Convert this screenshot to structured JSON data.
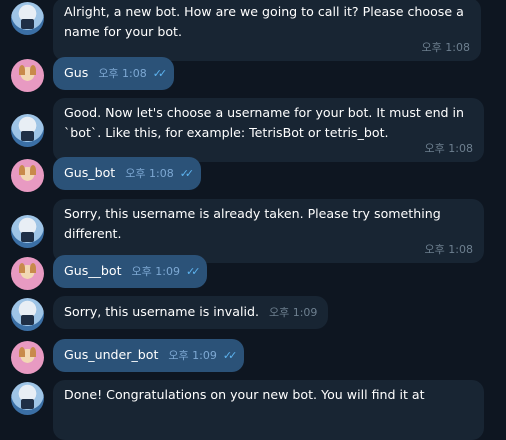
{
  "messages": [
    {
      "from": "bot",
      "text": "Alright, a new bot. How are we going to call it? Please choose a name for your bot.",
      "time": "오후 1:08"
    },
    {
      "from": "user",
      "text": "Gus",
      "time": "오후 1:08",
      "status": "read"
    },
    {
      "from": "bot",
      "text": "Good. Now let's choose a username for your bot. It must end in `bot`. Like this, for example: TetrisBot or tetris_bot.",
      "time": "오후 1:08"
    },
    {
      "from": "user",
      "text": "Gus_bot",
      "time": "오후 1:08",
      "status": "read"
    },
    {
      "from": "bot",
      "text": "Sorry, this username is already taken. Please try something different.",
      "time": "오후 1:08"
    },
    {
      "from": "user",
      "text": "Gus__bot",
      "time": "오후 1:09",
      "status": "read"
    },
    {
      "from": "bot",
      "text": "Sorry, this username is invalid.",
      "time": "오후 1:09"
    },
    {
      "from": "user",
      "text": "Gus_under_bot",
      "time": "오후 1:09",
      "status": "read"
    },
    {
      "from": "bot",
      "text": "Done! Congratulations on your new bot. You will find it at",
      "time": ""
    }
  ],
  "icons": {
    "bot_avatar": "bot-avatar",
    "user_avatar": "user-avatar",
    "read_status": "double-check-icon"
  },
  "colors": {
    "background": "#0e1621",
    "incoming_bubble": "#182533",
    "outgoing_bubble": "#2b5278",
    "read_check": "#5db3ef"
  }
}
